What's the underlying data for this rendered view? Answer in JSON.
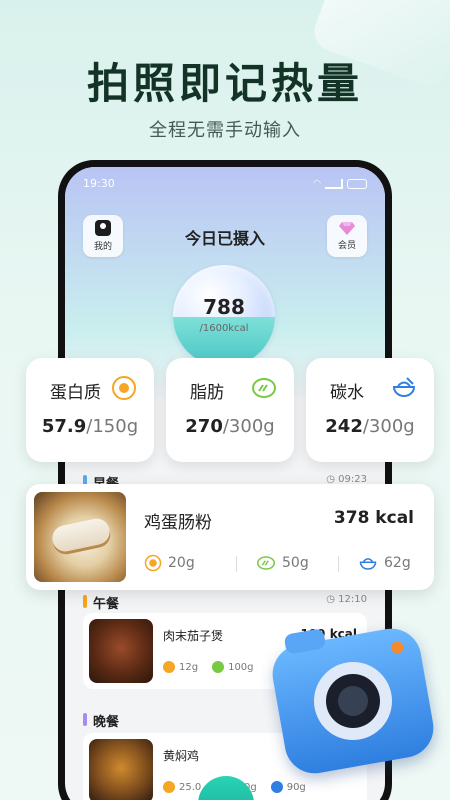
{
  "hero": {
    "title": "拍照即记热量",
    "subtitle": "全程无需手动输入"
  },
  "phone": {
    "status_time": "19:30",
    "nav_left": "我的",
    "nav_right": "会员",
    "title": "今日已摄入",
    "intake": "788",
    "goal": "/1600kcal",
    "intake_fraction": 0.49
  },
  "nutrients": [
    {
      "name": "蛋白质",
      "value": "57.9",
      "target": "/150g",
      "icon": "egg-icon"
    },
    {
      "name": "脂肪",
      "value": "270",
      "target": "/300g",
      "icon": "avocado-icon"
    },
    {
      "name": "碳水",
      "value": "242",
      "target": "/300g",
      "icon": "rice-bowl-icon"
    }
  ],
  "meals": {
    "breakfast": {
      "label": "早餐",
      "time": "09:23"
    },
    "lunch": {
      "label": "午餐",
      "time": "12:10",
      "item": {
        "name": "肉末茄子煲",
        "kcal": "199 kcal",
        "protein": "12g",
        "fat": "100g"
      }
    },
    "dinner": {
      "label": "晚餐",
      "item": {
        "name": "黄焖鸡",
        "protein": "25.0",
        "fat": "120g",
        "carb": "90g"
      }
    }
  },
  "featured": {
    "name": "鸡蛋肠粉",
    "kcal": "378 kcal",
    "protein": "20g",
    "fat": "50g",
    "carb": "62g"
  },
  "colors": {
    "protein": "#f5a623",
    "fat": "#7ac943",
    "carb": "#2f7fe0",
    "breakfast_bar": "#5aa9f0",
    "lunch_bar": "#f5a623",
    "dinner_bar": "#a98bef"
  }
}
